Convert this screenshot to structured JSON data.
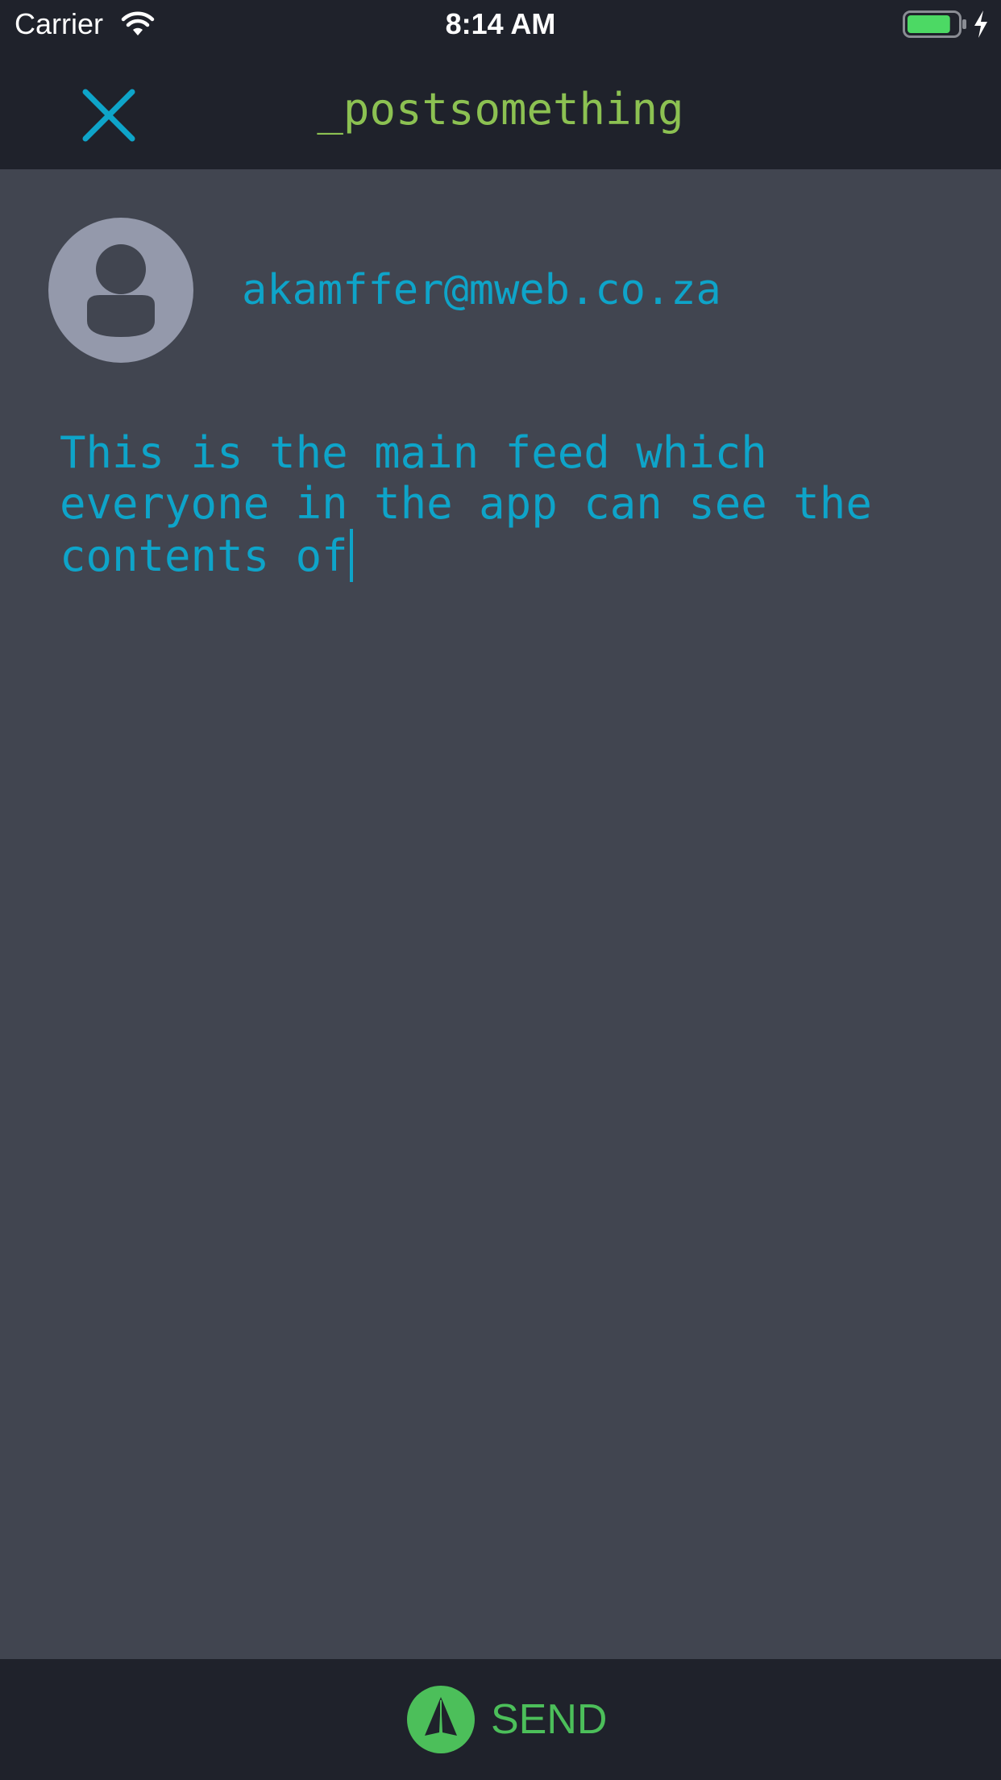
{
  "status_bar": {
    "carrier": "Carrier",
    "time": "8:14 AM",
    "wifi_icon": "wifi-icon",
    "battery_icon": "battery-icon",
    "charging_icon": "charging-bolt-icon",
    "battery_color": "#4cd964",
    "battery_level": 0.85
  },
  "nav": {
    "close_icon": "close-icon",
    "title": "_postsomething"
  },
  "composer": {
    "avatar_icon": "person-icon",
    "email": "akamffer@mweb.co.za",
    "post_text": "This is the main feed which\neveryone in the app can see the\ncontents of"
  },
  "footer": {
    "send_icon": "paper-plane-icon",
    "send_label": "SEND"
  },
  "colors": {
    "accent": "#0ea4c9",
    "title_green": "#8cc152",
    "send_green": "#4cbf5a",
    "bar_background": "#1f222b",
    "content_background": "#414550",
    "avatar_background": "#9499ab"
  }
}
